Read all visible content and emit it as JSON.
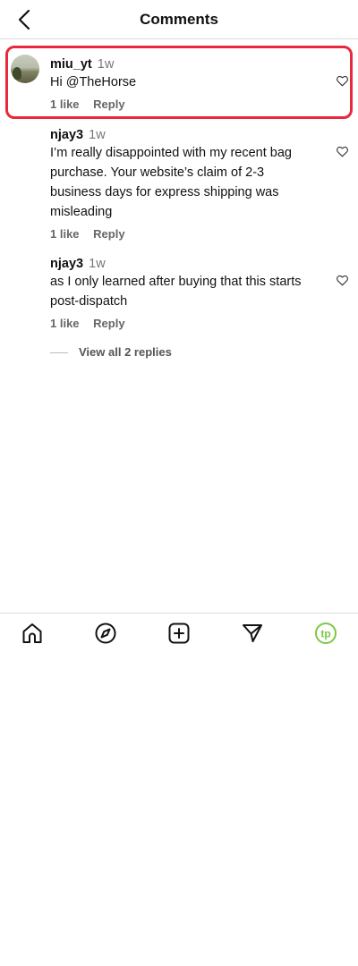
{
  "header": {
    "title": "Comments",
    "back_icon": "chevron-left-icon"
  },
  "comments": [
    {
      "username": "miu_yt",
      "time": "1w",
      "text": "Hi @TheHorse",
      "likes": "1 like",
      "reply": "Reply"
    },
    {
      "username": "njay3",
      "time": "1w",
      "text": "I’m really disappointed with my recent bag purchase. Your website’s claim of 2-3 business days for express shipping was misleading",
      "likes": "1 like",
      "reply": "Reply"
    },
    {
      "username": "njay3",
      "time": "1w",
      "text": "as I only learned after buying that this starts post-dispatch",
      "likes": "1 like",
      "reply": "Reply"
    }
  ],
  "view_replies": "View all 2 replies",
  "tabbar": {
    "items": [
      "home-icon",
      "explore-compass-icon",
      "create-plus-icon",
      "send-icon",
      "profile-tp-icon"
    ]
  },
  "colors": {
    "highlight": "#e8283c",
    "profile_accent": "#7ac943"
  },
  "profile_initials": "tp"
}
